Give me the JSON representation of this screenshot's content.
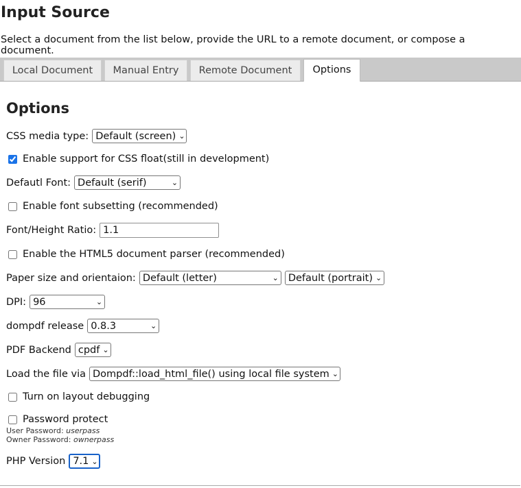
{
  "page": {
    "title": "Input Source",
    "intro": "Select a document from the list below, provide the URL to a remote document, or compose a document."
  },
  "tabs": [
    {
      "label": "Local Document",
      "active": false
    },
    {
      "label": "Manual Entry",
      "active": false
    },
    {
      "label": "Remote Document",
      "active": false
    },
    {
      "label": "Options",
      "active": true
    }
  ],
  "options": {
    "heading": "Options",
    "media_type": {
      "label": "CSS media type:",
      "value": "Default (screen)"
    },
    "css_float": {
      "label": "Enable support for CSS float(still in development)",
      "checked": true
    },
    "default_font": {
      "label": "Defautl Font:",
      "value": "Default (serif)"
    },
    "font_subsetting": {
      "label": "Enable font subsetting (recommended)",
      "checked": false
    },
    "font_height_ratio": {
      "label": "Font/Height Ratio:",
      "value": "1.1"
    },
    "html5_parser": {
      "label": "Enable the HTML5 document parser (recommended)",
      "checked": false
    },
    "paper": {
      "label": "Paper size and orientaion:",
      "size_value": "Default (letter)",
      "orientation_value": "Default (portrait)"
    },
    "dpi": {
      "label": "DPI:",
      "value": "96"
    },
    "release": {
      "label": "dompdf release",
      "value": "0.8.3"
    },
    "backend": {
      "label": "PDF Backend",
      "value": "cpdf"
    },
    "load_via": {
      "label": "Load the file via",
      "value": "Dompdf::load_html_file() using local file system"
    },
    "layout_debugging": {
      "label": "Turn on layout debugging",
      "checked": false
    },
    "password_protect": {
      "label": "Password protect",
      "checked": false,
      "user_label": "User Password:",
      "user_value": "userpass",
      "owner_label": "Owner Password:",
      "owner_value": "ownerpass"
    },
    "php_version": {
      "label": "PHP Version",
      "value": "7.1"
    }
  },
  "icons": {
    "select_arrow": "chevron-down-icon"
  },
  "colors": {
    "focus_ring": "#1862c9",
    "tabbar_bg": "#c9c9c9",
    "checkbox_accent": "#1a73e8"
  }
}
